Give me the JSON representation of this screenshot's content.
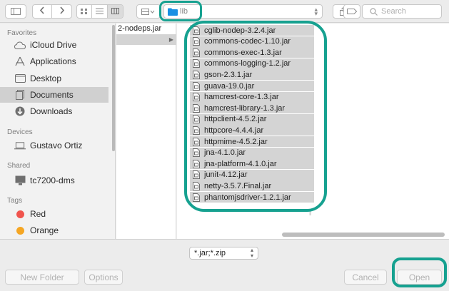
{
  "toolbar": {
    "location": "lib",
    "search_placeholder": "Search",
    "icons": [
      "sidebar-toggle-icon",
      "back-icon",
      "forward-icon",
      "icon-view-icon",
      "list-view-icon",
      "column-view-icon",
      "gallery-view-icon",
      "share-icon",
      "tag-icon",
      "search-icon"
    ]
  },
  "sidebar": {
    "favorites_title": "Favorites",
    "favorites": [
      {
        "label": "iCloud Drive",
        "icon": "cloud-icon"
      },
      {
        "label": "Applications",
        "icon": "applications-icon"
      },
      {
        "label": "Desktop",
        "icon": "desktop-icon"
      },
      {
        "label": "Documents",
        "icon": "documents-icon",
        "selected": true
      },
      {
        "label": "Downloads",
        "icon": "downloads-icon"
      }
    ],
    "devices_title": "Devices",
    "devices": [
      {
        "label": "Gustavo Ortiz",
        "icon": "laptop-icon"
      }
    ],
    "shared_title": "Shared",
    "shared": [
      {
        "label": "tc7200-dms",
        "icon": "monitor-icon"
      }
    ],
    "tags_title": "Tags",
    "tags": [
      {
        "label": "Red",
        "color": "#f0544d"
      },
      {
        "label": "Orange",
        "color": "#f5a623"
      }
    ]
  },
  "column1": {
    "item": "2-nodeps.jar"
  },
  "files": [
    "cglib-nodep-3.2.4.jar",
    "commons-codec-1.10.jar",
    "commons-exec-1.3.jar",
    "commons-logging-1.2.jar",
    "gson-2.3.1.jar",
    "guava-19.0.jar",
    "hamcrest-core-1.3.jar",
    "hamcrest-library-1.3.jar",
    "httpclient-4.5.2.jar",
    "httpcore-4.4.4.jar",
    "httpmime-4.5.2.jar",
    "jna-4.1.0.jar",
    "jna-platform-4.1.0.jar",
    "junit-4.12.jar",
    "netty-3.5.7.Final.jar",
    "phantomjsdriver-1.2.1.jar"
  ],
  "bottom": {
    "filter": "*.jar;*.zip",
    "new_folder": "New Folder",
    "options": "Options",
    "cancel": "Cancel",
    "open": "Open"
  },
  "colors": {
    "highlight": "#16a190",
    "selection": "#d4d4d4"
  }
}
